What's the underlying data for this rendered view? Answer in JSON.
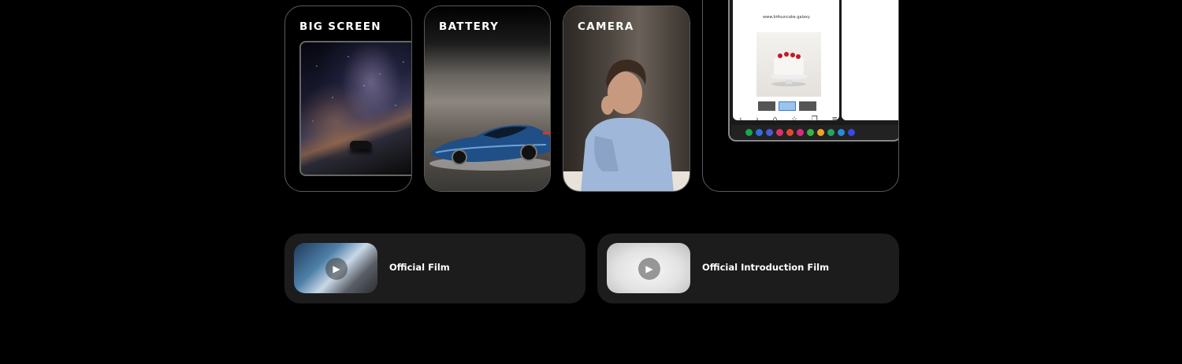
{
  "feature_cards": [
    {
      "title": "BIG SCREEN"
    },
    {
      "title": "BATTERY"
    },
    {
      "title": "CAMERA"
    }
  ],
  "multitask_card": {
    "url": "www.bi4suncake.galaxy"
  },
  "films": [
    {
      "label": "Official Film",
      "icon": "play-icon"
    },
    {
      "label": "Official Introduction Film",
      "icon": "play-icon"
    }
  ],
  "colors": {
    "background": "#000000",
    "card_border": "#5a5a5a",
    "film_card_bg": "#1c1c1c",
    "text": "#ffffff"
  }
}
